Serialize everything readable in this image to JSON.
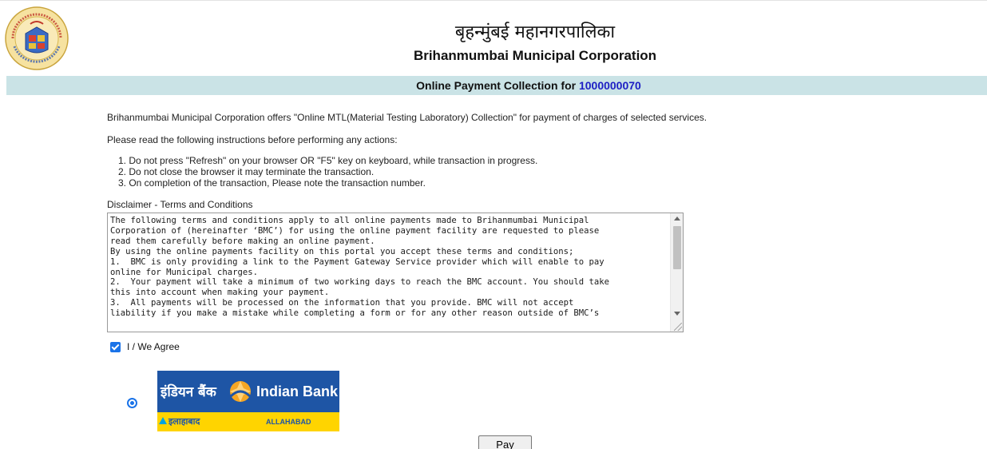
{
  "header": {
    "title_hindi": "बृहन्मुंबई महानगरपालिका",
    "title_english": "Brihanmumbai Municipal Corporation",
    "logo_icon": "bmc-emblem-icon"
  },
  "band": {
    "label": "Online Payment Collection for",
    "reference_number": "1000000070"
  },
  "intro": "Brihanmumbai Municipal Corporation offers \"Online MTL(Material Testing Laboratory) Collection\" for payment of charges of selected services.",
  "instructions_heading": "Please read the following instructions before performing any actions:",
  "instructions": [
    "1. Do not press \"Refresh\" on your browser OR \"F5\" key on keyboard, while transaction in progress.",
    "2. Do not close the browser it may terminate the transaction.",
    "3. On completion of the transaction, Please note the transaction number."
  ],
  "disclaimer": {
    "label": "Disclaimer - Terms and Conditions",
    "text": "The following terms and conditions apply to all online payments made to Brihanmumbai Municipal\nCorporation of (hereinafter ‘BMC’) for using the online payment facility are requested to please\nread them carefully before making an online payment.\nBy using the online payments facility on this portal you accept these terms and conditions;\n1.  BMC is only providing a link to the Payment Gateway Service provider which will enable to pay\nonline for Municipal charges.\n2.  Your payment will take a minimum of two working days to reach the BMC account. You should take\nthis into account when making your payment.\n3.  All payments will be processed on the information that you provide. BMC will not accept\nliability if you make a mistake while completing a form or for any other reason outside of BMC’s"
  },
  "agree": {
    "label": "I / We Agree",
    "checked": true
  },
  "bank": {
    "name_hindi": "इंडियन बैंक",
    "name_english": "Indian Bank",
    "sub_hindi": "इलाहाबाद",
    "sub_english": "ALLAHABAD",
    "selected": true,
    "colors": {
      "top": "#1e55a5",
      "bottom": "#ffd400",
      "emblem": "#f5a623"
    }
  },
  "pay_button": "Pay"
}
